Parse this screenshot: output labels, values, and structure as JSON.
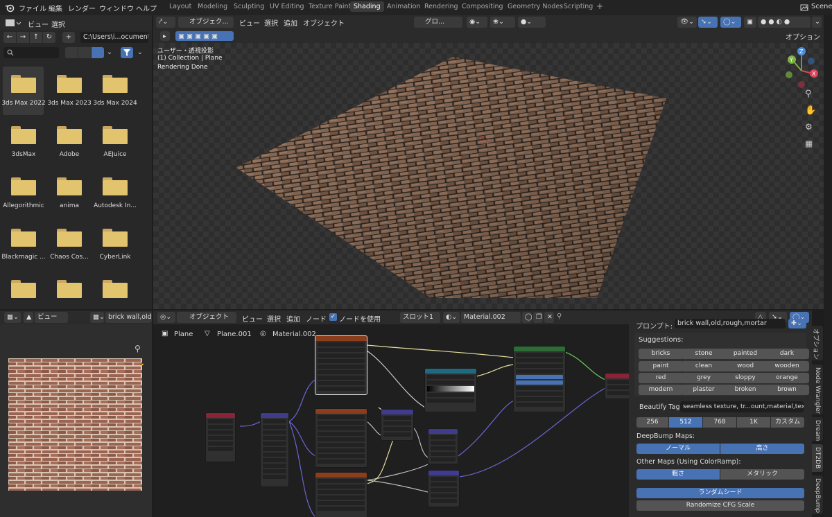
{
  "topbar": {
    "menus": [
      "ファイル",
      "編集",
      "レンダー",
      "ウィンドウ",
      "ヘルプ"
    ],
    "workspaces": [
      "Layout",
      "Modeling",
      "Sculpting",
      "UV Editing",
      "Texture Paint",
      "Shading",
      "Animation",
      "Rendering",
      "Compositing",
      "Geometry Nodes",
      "Scripting"
    ],
    "active_workspace": "Shading",
    "scene_label": "Scene"
  },
  "file_browser": {
    "menus": [
      "ビュー",
      "選択"
    ],
    "path": "C:\\Users\\i...ocuments\\",
    "folders": [
      "3ds Max 2022",
      "3ds Max 2023",
      "3ds Max 2024",
      "3dsMax",
      "Adobe",
      "AEJuice",
      "Allegorithmic",
      "anima",
      "Autodesk In...",
      "Blackmagic ...",
      "Chaos Cos...",
      "CyberLink",
      "",
      "",
      ""
    ]
  },
  "viewport": {
    "mode": "オブジェク...",
    "menus": [
      "ビュー",
      "選択",
      "追加",
      "オブジェクト"
    ],
    "transform": "グロ...",
    "options_label": "オプション",
    "info": [
      "ユーザー・透視投影",
      "(1) Collection | Plane",
      "Rendering Done"
    ]
  },
  "image_editor": {
    "menu": "ビュー",
    "image_name": "brick wall,old,ro"
  },
  "node_editor": {
    "mode": "オブジェクト",
    "menus": [
      "ビュー",
      "選択",
      "追加",
      "ノード"
    ],
    "use_nodes_label": "ノードを使用",
    "slot": "スロット1",
    "material": "Material.002",
    "breadcrumb": [
      "Plane",
      "Plane.001",
      "Material.002"
    ]
  },
  "panel": {
    "prompt_label": "プロンプト:",
    "prompt_value": "brick wall,old,rough,mortar",
    "suggestions_label": "Suggestions:",
    "tags": [
      "bricks",
      "stone",
      "painted",
      "dark",
      "paint",
      "clean",
      "wood",
      "wooden",
      "red",
      "grey",
      "sloppy",
      "orange",
      "modern",
      "plaster",
      "broken",
      "brown"
    ],
    "beautify_label": "Beautify Tags:",
    "beautify_value": "seamless texture, tr...ount,material,texture",
    "resolutions": [
      "256",
      "512",
      "768",
      "1K",
      "カスタム"
    ],
    "selected_resolution": "512",
    "deepbump_label": "DeepBump Maps:",
    "deepbump_options": [
      "ノーマル",
      "高さ"
    ],
    "other_maps_label": "Other Maps (Using ColorRamp):",
    "other_maps_options": [
      "粗さ",
      "メタリック"
    ],
    "random_seed_label": "ランダムシード",
    "randomize_cfg_label": "Randomize CFG Scale",
    "side_tabs": [
      "オプション",
      "Node Wrangler",
      "Dream",
      "DT2DB",
      "DeepBump"
    ]
  },
  "colors": {
    "accent": "#4772b3",
    "folder": "#e2c36e",
    "node_texture": "#8b3d1c",
    "node_shader": "#2d6b37",
    "node_vector": "#3f3c8f",
    "node_input": "#8b2336",
    "node_converter": "#1f6983"
  }
}
